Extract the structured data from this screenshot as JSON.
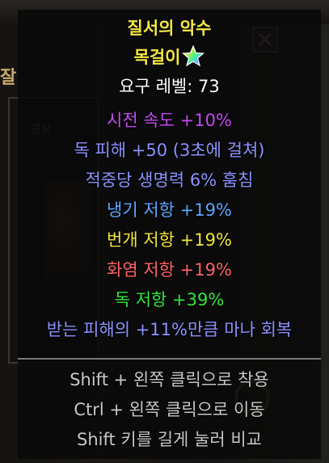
{
  "background": {
    "slot_label": "공유",
    "side_glyph": "잘"
  },
  "tooltip": {
    "item_name": "질서의 악수",
    "item_type": "목걸이",
    "required_level": "요구 레벨: 73",
    "affixes": [
      {
        "text": "시전 속도 +10%",
        "color": "#c44af0"
      },
      {
        "text": "독 피해 +50 (3초에 걸쳐)",
        "color": "#8c92ff"
      },
      {
        "text": "적중당 생명력 6% 훔침",
        "color": "#8c92ff"
      },
      {
        "text": "냉기 저항 +19%",
        "color": "#5ba7ff"
      },
      {
        "text": "번개 저항 +19%",
        "color": "#f2e53a"
      },
      {
        "text": "화염 저항 +19%",
        "color": "#ff6464"
      },
      {
        "text": "독 저항 +39%",
        "color": "#35e63a"
      },
      {
        "text": "받는 피해의 +11%만큼 마나 회복",
        "color": "#8c92ff"
      }
    ],
    "hints": [
      "Shift + 왼쪽 클릭으로 착용",
      "Ctrl + 왼쪽 클릭으로 이동",
      "Shift 키를 길게 눌러 비교"
    ]
  },
  "colors": {
    "name": "#f5e845",
    "type": "#f5e845",
    "level": "#ffffff",
    "hint": "#c8c8c8"
  },
  "icons": {
    "type_badge": "rainbow-star-icon",
    "close": "close-icon"
  }
}
